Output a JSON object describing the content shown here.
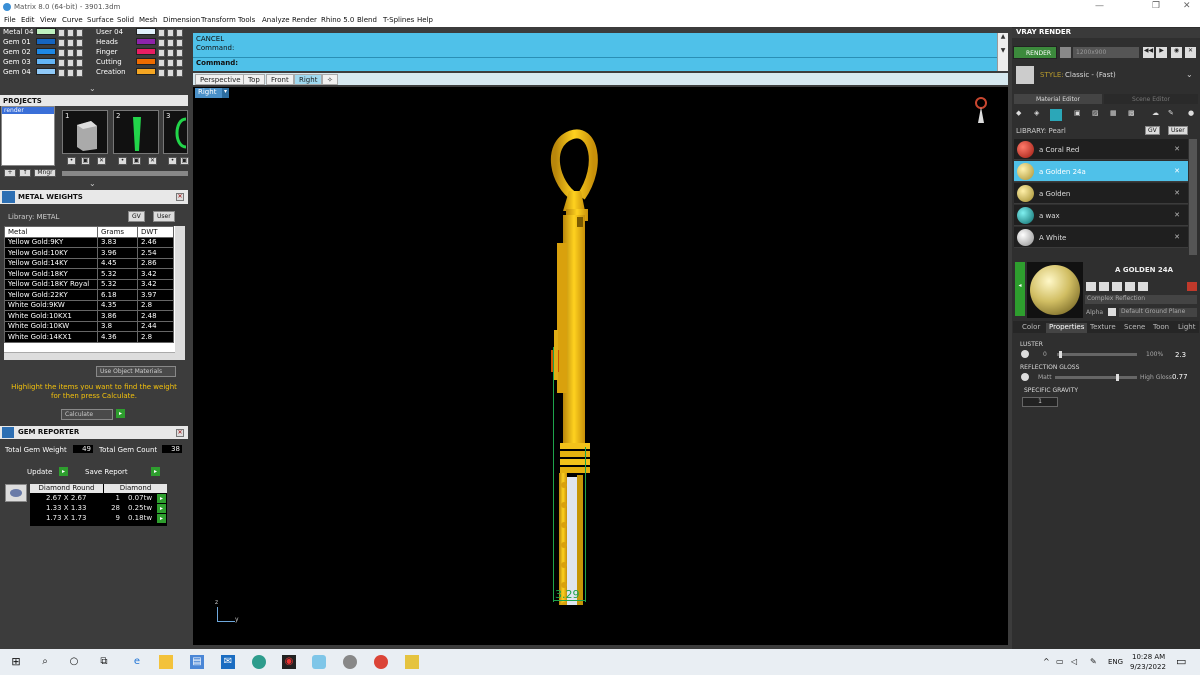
{
  "window": {
    "title": "Matrix 8.0 (64-bit) - 3901.3dm",
    "min": "—",
    "max": "❐",
    "close": "✕"
  },
  "menu": [
    "File",
    "Edit",
    "View",
    "Curve",
    "Surface",
    "Solid",
    "Mesh",
    "Dimension",
    "Transform",
    "Tools",
    "Analyze",
    "Render",
    "Rhino 5.0",
    "Blend",
    "T-Splines",
    "Help"
  ],
  "layers": {
    "left": [
      {
        "label": "Metal 04",
        "color": "#bff2c0"
      },
      {
        "label": "Gem 01",
        "color": "#1565c0"
      },
      {
        "label": "Gem 02",
        "color": "#1e88e5"
      },
      {
        "label": "Gem 03",
        "color": "#64b5f6"
      },
      {
        "label": "Gem 04",
        "color": "#90caf9"
      }
    ],
    "right": [
      {
        "label": "User 04",
        "color": "#e3f2fd"
      },
      {
        "label": "Heads",
        "color": "#8e24aa"
      },
      {
        "label": "Finger",
        "color": "#e91e63"
      },
      {
        "label": "Cutting",
        "color": "#ef6c00"
      },
      {
        "label": "Creation",
        "color": "#f5a623"
      }
    ]
  },
  "projects": {
    "title": "PROJECTS",
    "selected": "render",
    "thumbs": [
      "1",
      "2",
      "3"
    ],
    "buttons": {
      "mngr": "Mngr"
    }
  },
  "metal_weights": {
    "title": "METAL WEIGHTS",
    "library": "Library: METAL",
    "gv": "GV",
    "user": "User",
    "columns": [
      "Metal",
      "Grams",
      "DWT"
    ],
    "rows": [
      [
        "Yellow Gold:9KY",
        "3.83",
        "2.46"
      ],
      [
        "Yellow Gold:10KY",
        "3.96",
        "2.54"
      ],
      [
        "Yellow Gold:14KY",
        "4.45",
        "2.86"
      ],
      [
        "Yellow Gold:18KY",
        "5.32",
        "3.42"
      ],
      [
        "Yellow Gold:18KY Royal",
        "5.32",
        "3.42"
      ],
      [
        "Yellow Gold:22KY",
        "6.18",
        "3.97"
      ],
      [
        "White Gold:9KW",
        "4.35",
        "2.8"
      ],
      [
        "White Gold:10KX1",
        "3.86",
        "2.48"
      ],
      [
        "White Gold:10KW",
        "3.8",
        "2.44"
      ],
      [
        "White Gold:14KX1",
        "4.36",
        "2.8"
      ]
    ],
    "use_object_materials": "Use Object Materials",
    "hint": "Highlight the items you want to find the weight for then press Calculate.",
    "calculate": "Calculate"
  },
  "gem_reporter": {
    "title": "GEM REPORTER",
    "total_weight_label": "Total Gem Weight",
    "total_weight": "49",
    "total_count_label": "Total Gem Count",
    "total_count": "38",
    "update": "Update",
    "save": "Save Report",
    "headers": [
      "Diamond Round",
      "Diamond"
    ],
    "rows": [
      [
        "2.67 X 2.67",
        "1",
        "0.07tw"
      ],
      [
        "1.33 X 1.33",
        "28",
        "0.25tw"
      ],
      [
        "1.73 X 1.73",
        "9",
        "0.18tw"
      ]
    ]
  },
  "command": {
    "line1": "CANCEL",
    "line2": "Command:",
    "prompt": "Command:"
  },
  "view_tabs": [
    "Perspective",
    "Top",
    "Front",
    "Right"
  ],
  "active_tab": "Right",
  "viewport_label": "Right",
  "dimension": "3.29",
  "axis": {
    "z": "z",
    "y": "y"
  },
  "vray": {
    "title": "VRAY RENDER",
    "render": "RENDER",
    "size": "1200x900",
    "style_label": "STYLE:",
    "style_value": "Classic - (Fast)",
    "tab_material": "Material Editor",
    "tab_scene": "Scene Editor",
    "library": "LIBRARY: Pearl",
    "gv": "GV",
    "user": "User",
    "materials": [
      {
        "name": "a Coral Red",
        "color": "#c62828"
      },
      {
        "name": "a Golden 24a",
        "color": "#d4c26a"
      },
      {
        "name": "a Golden",
        "color": "#cdbb62"
      },
      {
        "name": "a wax",
        "color": "#1aa3a3"
      },
      {
        "name": "A White",
        "color": "#d9d9d9"
      }
    ],
    "selected_material": "A GOLDEN 24A",
    "complex": "Complex Reflection",
    "alpha": "Alpha",
    "ground": "Default Ground Plane",
    "prop_tabs": [
      "Color",
      "Properties",
      "Texture",
      "Scene",
      "Toon",
      "Light"
    ],
    "luster_label": "LUSTER",
    "luster_min": "0",
    "luster_max": "100%",
    "luster_value": "2.3",
    "luster_level": 0.02,
    "gloss_label": "REFLECTION GLOSS",
    "gloss_min": "Matt",
    "gloss_max": "High Gloss",
    "gloss_value": "0.77",
    "gloss_level": 0.77,
    "gravity_label": "SPECIFIC GRAVITY",
    "gravity_value": "1"
  },
  "taskbar": {
    "lang": "ENG",
    "time": "10:28 AM",
    "date": "9/23/2022"
  }
}
